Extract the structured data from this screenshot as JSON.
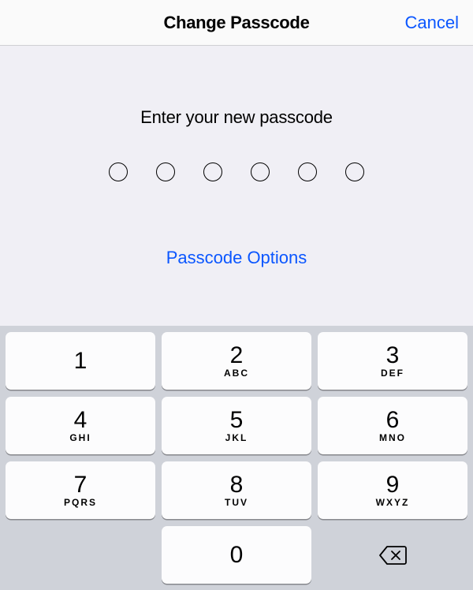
{
  "nav": {
    "title": "Change Passcode",
    "cancel": "Cancel"
  },
  "content": {
    "prompt": "Enter your new passcode",
    "options": "Passcode Options",
    "passcode_length": 6
  },
  "keypad": {
    "keys": [
      [
        {
          "digit": "1",
          "letters": ""
        },
        {
          "digit": "2",
          "letters": "ABC"
        },
        {
          "digit": "3",
          "letters": "DEF"
        }
      ],
      [
        {
          "digit": "4",
          "letters": "GHI"
        },
        {
          "digit": "5",
          "letters": "JKL"
        },
        {
          "digit": "6",
          "letters": "MNO"
        }
      ],
      [
        {
          "digit": "7",
          "letters": "PQRS"
        },
        {
          "digit": "8",
          "letters": "TUV"
        },
        {
          "digit": "9",
          "letters": "WXYZ"
        }
      ],
      [
        {
          "digit": "",
          "letters": "",
          "blank": true
        },
        {
          "digit": "0",
          "letters": ""
        },
        {
          "digit": "",
          "letters": "",
          "delete": true
        }
      ]
    ]
  }
}
